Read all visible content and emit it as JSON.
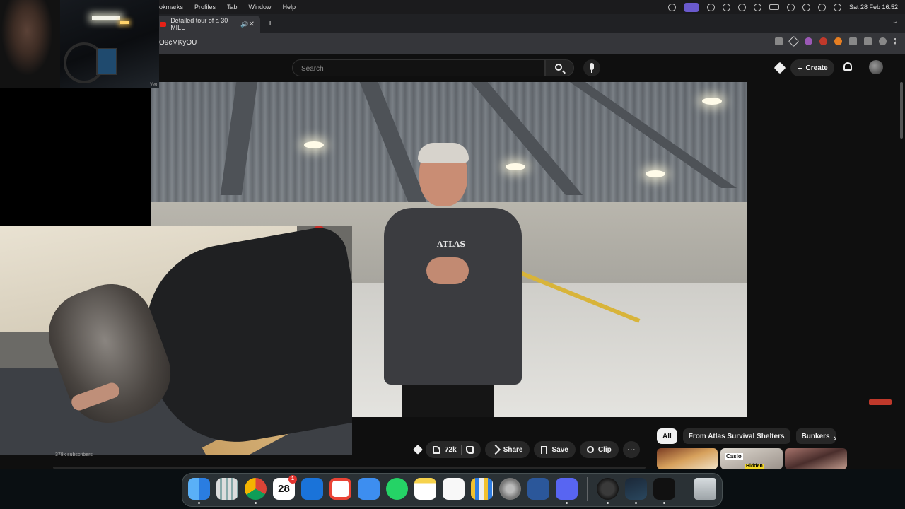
{
  "menubar": {
    "menus": [
      "ookmarks",
      "Profiles",
      "Tab",
      "Window",
      "Help"
    ],
    "clock": "Sat 28 Feb  16:52"
  },
  "browser": {
    "tab_title": "Detailed tour of a 30 MILL",
    "url": "O9cMKyOU",
    "new_tab_label": "+"
  },
  "youtube": {
    "search_placeholder": "Search",
    "create_label": "Create",
    "create_icon": "plus-icon"
  },
  "video": {
    "shirt_text": "ATLAS"
  },
  "overlay": {
    "webcam_label": "Veo"
  },
  "actions": {
    "like_count": "72k",
    "share_label": "Share",
    "save_label": "Save",
    "clip_label": "Clip",
    "more_label": "⋯"
  },
  "chips": [
    "All",
    "From Atlas Survival Shelters",
    "Bunkers"
  ],
  "chip_next": "›",
  "channel": {
    "subscribers": "378k subscribers"
  },
  "thumbnails": [
    {
      "overlay_text": ""
    },
    {
      "overlay_text": "Casio",
      "overlay_text_2": "Hidden"
    },
    {
      "overlay_text": ""
    }
  ],
  "dock": {
    "calendar_day": "28",
    "calendar_badge": "1",
    "apps": [
      "Finder",
      "Launchpad",
      "Chrome",
      "Calendar",
      "Outlook",
      "Gmail",
      "Mail",
      "WhatsApp",
      "Notes",
      "Reminders",
      "Keynote",
      "System Settings",
      "Word",
      "Discord",
      "OBS",
      "Steam",
      "Activity Monitor",
      "Trash"
    ]
  },
  "colors": {
    "youtube_red": "#e62117",
    "background": "#0f0f0f",
    "chip_active": "#f1f1f1",
    "button_bg": "#272727"
  }
}
